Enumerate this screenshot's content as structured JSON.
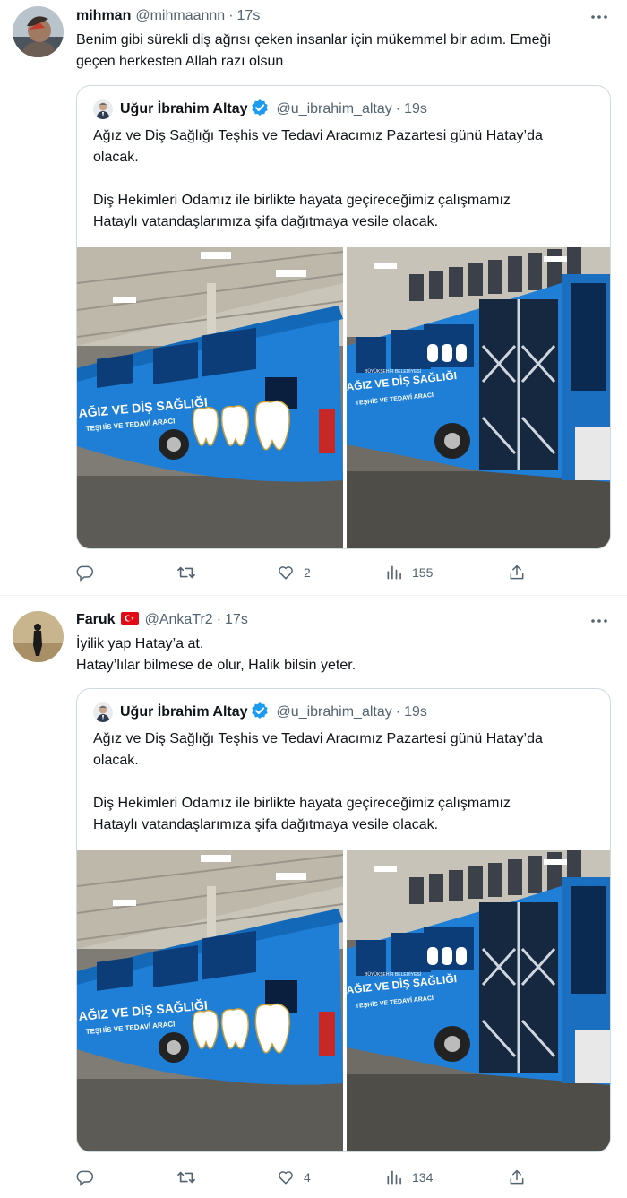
{
  "tweets": [
    {
      "name": "mihman",
      "handle": "@mihmaannn",
      "sep": "·",
      "time": "17s",
      "text": "Benim gibi sürekli diş ağrısı çeken insanlar için mükemmel bir adım. Emeği\ngeçen herkesten Allah razı olsun",
      "quote": {
        "name": "Uğur İbrahim Altay",
        "handle": "@u_ibrahim_altay",
        "sep": "·",
        "time": "19s",
        "text": "Ağız ve Diş Sağlığı Teşhis ve Tedavi Aracımız Pazartesi günü Hatay’da\nolacak.\n\nDiş Hekimleri Odamız ile birlikte hayata geçireceğimiz çalışmamız\nHataylı vatandaşlarımıza şifa dağıtmaya vesile olacak.",
        "bus_lettering": [
          "AĞIZ VE DİŞ SAĞLIĞI",
          "TEŞHİS VE TEDAVİ ARACI",
          "BÜYÜKŞEHİR BELEDİYESİ"
        ]
      },
      "actions": {
        "replies": "",
        "retweets": "",
        "likes": "2",
        "views": "155"
      }
    },
    {
      "name": "Faruk",
      "handle": "@AnkaTr2",
      "sep": "·",
      "time": "17s",
      "text": "İyilik yap Hatay’a at.\nHatay’lılar bilmese de olur, Halik bilsin yeter.",
      "quote": {
        "name": "Uğur İbrahim Altay",
        "handle": "@u_ibrahim_altay",
        "sep": "·",
        "time": "19s",
        "text": "Ağız ve Diş Sağlığı Teşhis ve Tedavi Aracımız Pazartesi günü Hatay’da\nolacak.\n\nDiş Hekimleri Odamız ile birlikte hayata geçireceğimiz çalışmamız\nHataylı vatandaşlarımıza şifa dağıtmaya vesile olacak.",
        "bus_lettering": [
          "AĞIZ VE DİŞ SAĞLIĞI",
          "TEŞHİS VE TEDAVİ ARACI",
          "BÜYÜKŞEHİR BELEDİYESİ"
        ]
      },
      "actions": {
        "replies": "",
        "retweets": "",
        "likes": "4",
        "views": "134"
      }
    }
  ],
  "colors": {
    "text": "#0f1419",
    "secondary": "#536471",
    "border": "#cfd9de",
    "verified": "#1d9bf0",
    "bus_blue": "#1f7fd6"
  },
  "icons": [
    "more-icon",
    "reply-icon",
    "retweet-icon",
    "like-icon",
    "views-icon",
    "share-icon",
    "verified-badge-icon",
    "turkey-flag-icon"
  ]
}
